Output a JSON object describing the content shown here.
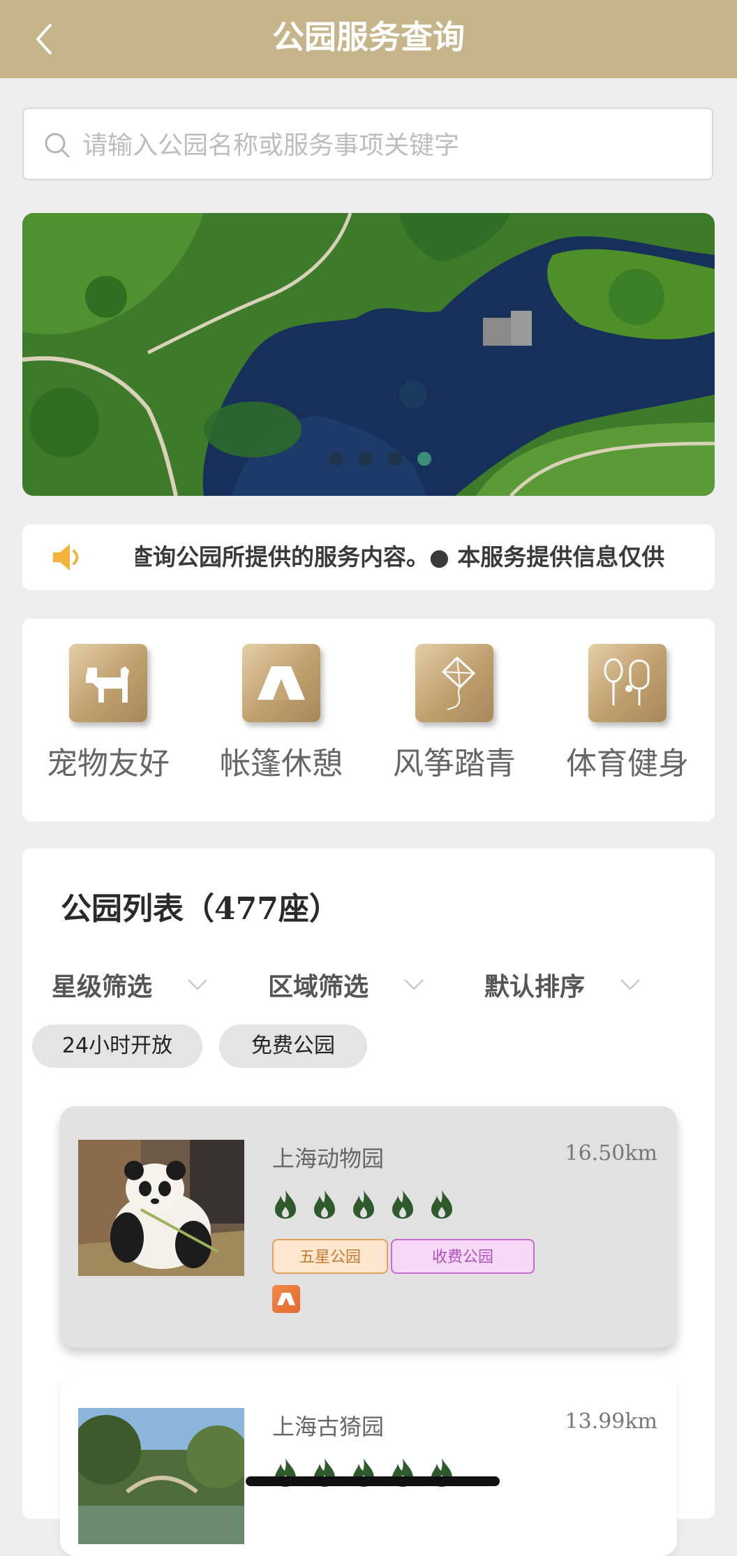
{
  "header": {
    "title": "公园服务查询",
    "back_icon": "chevron-left-icon"
  },
  "search": {
    "placeholder": "请输入公园名称或服务事项关键字",
    "icon": "search-icon"
  },
  "banner": {
    "slide_count": 4,
    "active_slide": 4
  },
  "notice": {
    "icon": "speaker-icon",
    "text": "查询公园所提供的服务内容。● 本服务提供信息仅供"
  },
  "services": [
    {
      "label": "宠物友好",
      "icon": "dog-icon"
    },
    {
      "label": "帐篷休憩",
      "icon": "tent-icon"
    },
    {
      "label": "风筝踏青",
      "icon": "kite-icon"
    },
    {
      "label": "体育健身",
      "icon": "sports-icon"
    }
  ],
  "park_list": {
    "title": "公园列表（477座）",
    "filters": [
      {
        "label": "星级筛选"
      },
      {
        "label": "区域筛选"
      },
      {
        "label": "默认排序"
      }
    ],
    "chips": [
      "24小时开放",
      "免费公园"
    ],
    "parks": [
      {
        "name": "上海动物园",
        "distance": "16.50km",
        "heat_level": 5,
        "tags": [
          "五星公园",
          "收费公园"
        ],
        "amenity_icon": "tent-icon"
      },
      {
        "name": "上海古猗园",
        "distance": "13.99km",
        "heat_level": 5,
        "tags": [
          "",
          ""
        ]
      }
    ]
  },
  "colors": {
    "header": "#c6b58b",
    "flame": "#2e5a2c",
    "active_dot": "#3c8c7a"
  }
}
